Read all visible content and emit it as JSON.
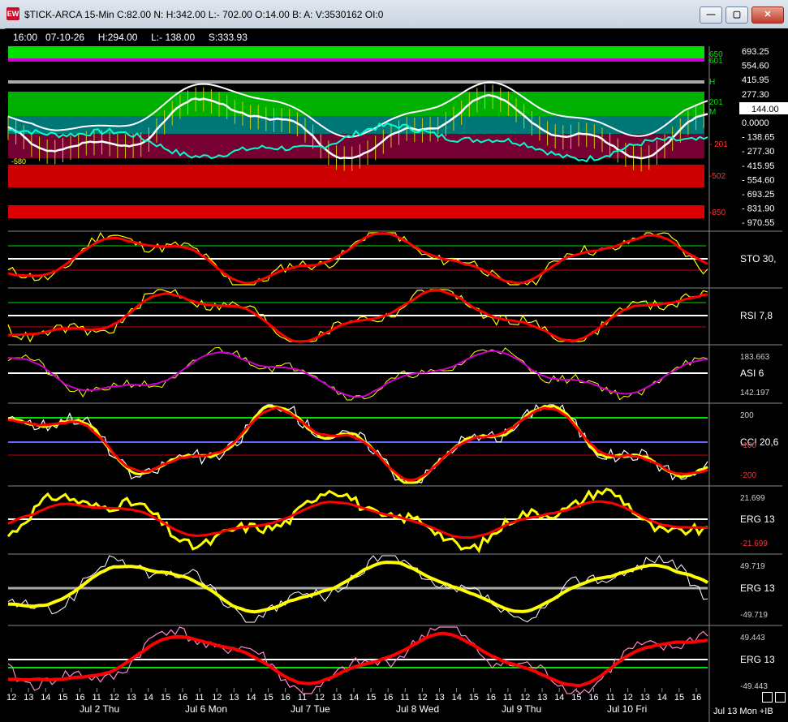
{
  "window": {
    "title": "$TICK-ARCA 15-Min C:82.00 N: H:342.00 L:- 702.00 O:14.00 B: A: V:3530162 OI:0",
    "app_icon": "EW",
    "buttons": {
      "minimize": "—",
      "maximize": "▢",
      "close": "✕"
    }
  },
  "info_line": "16:00   07-10-26     H:294.00     L:- 138.00     S:333.93",
  "colors": {
    "yellow": "#ffff00",
    "red": "#ff0000",
    "white": "#ffffff",
    "green": "#00e000",
    "magenta": "#cc00cc",
    "pink": "#ff88cc",
    "blue": "#6666ff",
    "gray": "#aaaaaa"
  },
  "price_axis": {
    "labels": [
      "693.25",
      "554.60",
      "415.95",
      "277.30",
      "144.00",
      "0.0000",
      "- 138.65",
      "- 277.30",
      "- 415.95",
      "- 554.60",
      "- 693.25",
      "- 831.90",
      "- 970.55"
    ],
    "levels": [
      "650",
      "601",
      "H",
      "201",
      "M",
      "- 201",
      "-502",
      "-850"
    ],
    "current_label": "144.00",
    "left_marker": "-580"
  },
  "panels": [
    {
      "id": "sto",
      "label": "STO  30,",
      "axis": []
    },
    {
      "id": "rsi",
      "label": "RSI  7,8",
      "axis": []
    },
    {
      "id": "asi",
      "label": "ASI  6",
      "axis": [
        "183.663",
        "142.197"
      ]
    },
    {
      "id": "cci",
      "label": "CCI  20,6",
      "axis": [
        "200",
        "-100",
        "-200"
      ]
    },
    {
      "id": "erg1",
      "label": "ERG  13",
      "axis": [
        "21.699",
        "-21.699"
      ]
    },
    {
      "id": "erg2",
      "label": "ERG  13",
      "axis": [
        "49.719",
        "-49.719"
      ]
    },
    {
      "id": "erg3",
      "label": "ERG  13",
      "axis": [
        "49.443",
        "-49.443"
      ]
    }
  ],
  "time_axis": {
    "hours": [
      "12",
      "13",
      "14",
      "15",
      "16",
      "11",
      "12",
      "13",
      "14",
      "15",
      "16",
      "11",
      "12",
      "13",
      "14",
      "15",
      "16",
      "11",
      "12",
      "13",
      "14",
      "15",
      "16",
      "11",
      "12",
      "13",
      "14",
      "15",
      "16",
      "11",
      "12",
      "13",
      "14",
      "15",
      "16",
      "11",
      "12",
      "13",
      "14",
      "15",
      "16"
    ],
    "days": [
      "Jul 2 Thu",
      "Jul 6 Mon",
      "Jul 7 Tue",
      "Jul 8 Wed",
      "Jul 9 Thu",
      "Jul 10 Fri"
    ],
    "right_label": "Jul 13 Mon +IB"
  }
}
